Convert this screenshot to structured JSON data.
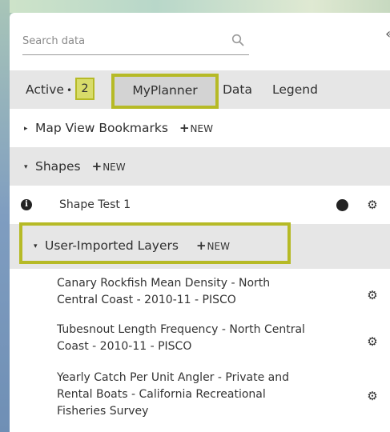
{
  "search": {
    "placeholder": "Search data"
  },
  "tabs": {
    "active_label": "Active",
    "active_separator": "•",
    "active_count": "2",
    "myplanner_label": "MyPlanner",
    "data_label": "Data",
    "legend_label": "Legend"
  },
  "new_label": "NEW",
  "sections": {
    "bookmarks": {
      "label": "Map View Bookmarks"
    },
    "shapes": {
      "label": "Shapes",
      "items": [
        {
          "label": "Shape Test 1"
        }
      ]
    },
    "imported": {
      "label": "User-Imported Layers",
      "items": [
        {
          "line1": "Canary Rockfish Mean Density - North",
          "line2": "Central Coast - 2010-11 - PISCO"
        },
        {
          "line1": "Tubesnout Length Frequency - North Central",
          "line2": "Coast - 2010-11 - PISCO"
        },
        {
          "line1": "Yearly Catch Per Unit Angler - Private and",
          "line2": "Rental Boats - California Recreational",
          "line3": "Fisheries Survey"
        }
      ]
    }
  },
  "colors": {
    "highlight": "#b6ba26",
    "badge_fill": "#d8dc6a",
    "section_gray": "#e6e6e6",
    "text": "#333333"
  },
  "icons": {
    "search": "search-icon",
    "collapse": "double-chevron-left-icon",
    "info": "info-icon",
    "color_swatch": "circle-icon",
    "settings": "gear-icon",
    "expand": "triangle-icon",
    "add": "plus-icon"
  }
}
